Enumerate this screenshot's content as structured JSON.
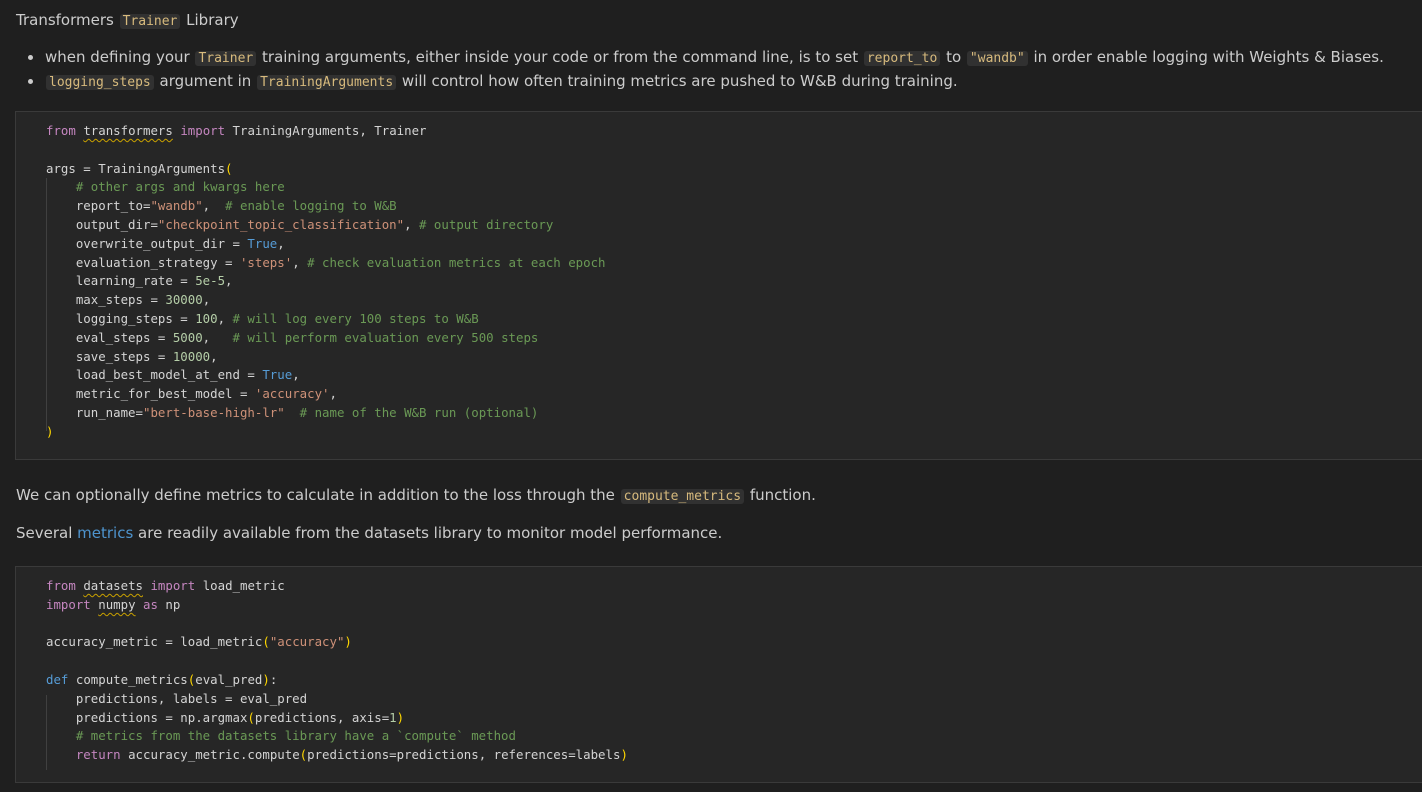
{
  "heading": {
    "before": "Transformers ",
    "code": "Trainer",
    "after": " Library"
  },
  "bullets": [
    {
      "t1": "when defining your ",
      "c1": "Trainer",
      "t2": " training arguments, either inside your code or from the command line, is to set ",
      "c2": "report_to",
      "t3": " to ",
      "c3": "\"wandb\"",
      "t4": " in order enable logging with Weights & Biases."
    },
    {
      "c1": "logging_steps",
      "t1": " argument in ",
      "c2": "TrainingArguments",
      "t2": " will control how often training metrics are pushed to W&B during training."
    }
  ],
  "code_block_1": {
    "line1": {
      "from": "from",
      "module": "transformers",
      "import": "import",
      "names": "TrainingArguments, Trainer"
    },
    "args_open": "args = TrainingArguments",
    "comment_other": "# other args and kwargs here",
    "report_to": {
      "key": "report_to=",
      "val": "\"wandb\"",
      "sep": ",  ",
      "cmt": "# enable logging to W&B"
    },
    "output_dir": {
      "key": "output_dir=",
      "val": "\"checkpoint_topic_classification\"",
      "sep": ", ",
      "cmt": "# output directory"
    },
    "overwrite": {
      "key": "overwrite_output_dir = ",
      "val": "True",
      "sep": ","
    },
    "eval_strategy": {
      "key": "evaluation_strategy = ",
      "val": "'steps'",
      "sep": ", ",
      "cmt": "# check evaluation metrics at each epoch"
    },
    "learning_rate": {
      "key": "learning_rate = ",
      "val": "5e-5",
      "sep": ","
    },
    "max_steps": {
      "key": "max_steps = ",
      "val": "30000",
      "sep": ","
    },
    "logging_steps": {
      "key": "logging_steps = ",
      "val": "100",
      "sep": ", ",
      "cmt": "# will log every 100 steps to W&B"
    },
    "eval_steps": {
      "key": "eval_steps = ",
      "val": "5000",
      "sep": ",   ",
      "cmt": "# will perform evaluation every 500 steps"
    },
    "save_steps": {
      "key": "save_steps = ",
      "val": "10000",
      "sep": ","
    },
    "load_best": {
      "key": "load_best_model_at_end = ",
      "val": "True",
      "sep": ","
    },
    "metric_best": {
      "key": "metric_for_best_model = ",
      "val": "'accuracy'",
      "sep": ","
    },
    "run_name": {
      "key": "run_name=",
      "val": "\"bert-base-high-lr\"",
      "sep": "  ",
      "cmt": "# name of the W&B run (optional)"
    }
  },
  "para1": {
    "before": "We can optionally define metrics to calculate in addition to the loss through the ",
    "code": "compute_metrics",
    "after": " function."
  },
  "para2": {
    "before": "Several ",
    "link": "metrics",
    "after": " are readily available from the datasets library to monitor model performance."
  },
  "code_block_2": {
    "line1": {
      "from": "from",
      "module": "datasets",
      "import": "import",
      "names": "load_metric"
    },
    "line2": {
      "import": "import",
      "module": "numpy",
      "as": "as",
      "alias": "np"
    },
    "acc_line": {
      "lhs": "accuracy_metric = load_metric",
      "arg": "\"accuracy\""
    },
    "def_line": {
      "def": "def",
      "name": "compute_metrics",
      "params": "eval_pred",
      "colon": ":"
    },
    "unpack": "predictions, labels = eval_pred",
    "argmax": {
      "lhs": "predictions = np.argmax",
      "args": "predictions, axis=",
      "num": "1"
    },
    "comment": "# metrics from the datasets library have a `compute` method",
    "return": {
      "kw": "return",
      "call": "accuracy_metric.compute",
      "args": "predictions=predictions, references=labels"
    }
  },
  "colors": {
    "background": "#1f1f1f",
    "code_background": "#262626",
    "keyword": "#569cd6",
    "string": "#ce9178",
    "comment": "#6a9955",
    "number": "#b5cea8",
    "inline_code": "#d7ba7d",
    "link": "#4e94ce",
    "bracket": "#ffd700"
  }
}
